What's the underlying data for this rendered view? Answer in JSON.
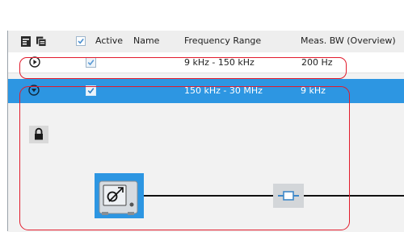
{
  "header": {
    "col_active": "Active",
    "col_name": "Name",
    "col_frequency": "Frequency Range",
    "col_meas_bw": "Meas. BW (Overview)"
  },
  "rows": [
    {
      "active": true,
      "name": "",
      "frequency_range": "9 kHz - 150 kHz",
      "meas_bw": "200 Hz",
      "expanded": false,
      "selected": false
    },
    {
      "active": true,
      "name": "",
      "frequency_range": "150 kHz - 30 MHz",
      "meas_bw": "9 kHz",
      "expanded": true,
      "selected": true
    }
  ],
  "colors": {
    "selection": "#2d96e2",
    "highlight_outline": "#e21b2c",
    "panel_bg": "#f2f2f2"
  },
  "icons": {
    "toolbar": [
      "expand-all-icon",
      "copy-icon"
    ],
    "row_collapsed": "expand-arrow-icon",
    "row_expanded": "collapse-arrow-icon",
    "lock": "lock-icon",
    "source": "transducer-icon",
    "filter": "filter-icon"
  }
}
